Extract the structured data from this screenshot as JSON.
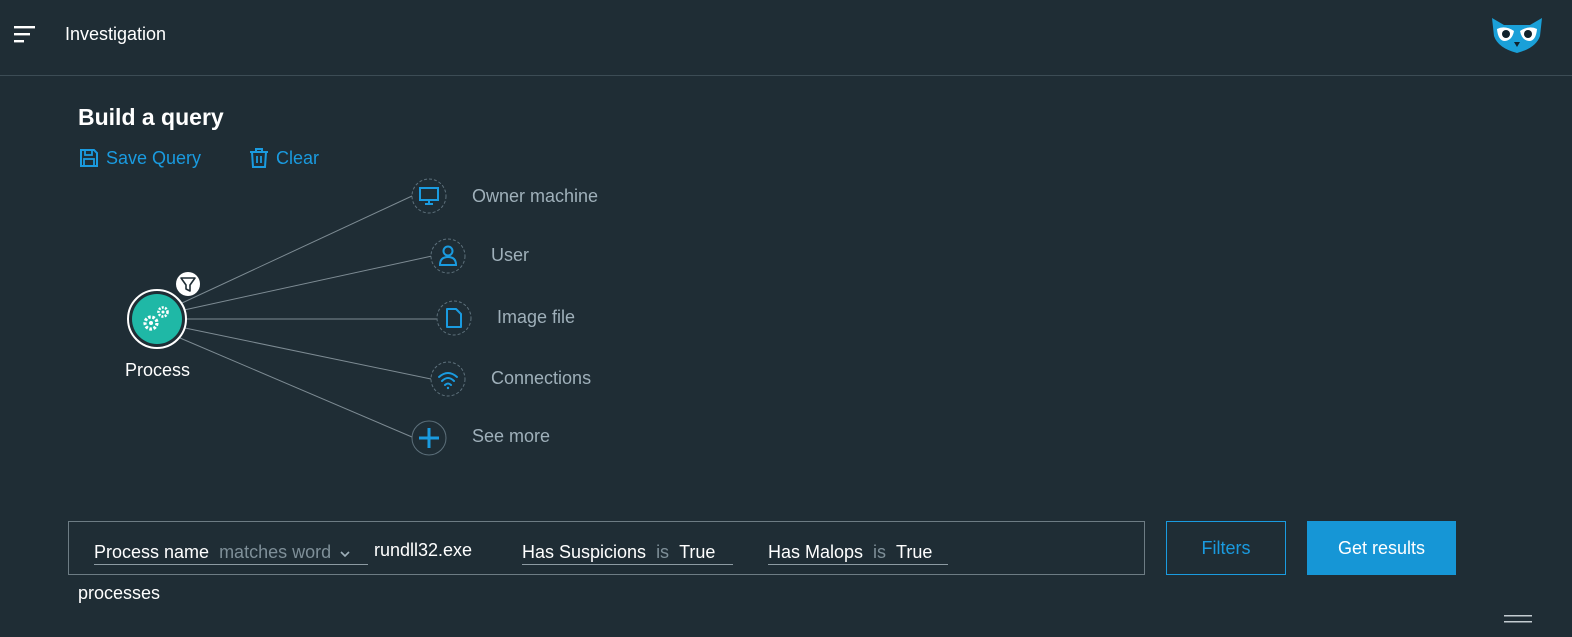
{
  "header": {
    "title": "Investigation"
  },
  "builder": {
    "title": "Build a query",
    "save_label": "Save Query",
    "clear_label": "Clear"
  },
  "graph": {
    "root_label": "Process",
    "nodes": [
      {
        "label": "Owner machine",
        "icon": "monitor-icon"
      },
      {
        "label": "User",
        "icon": "user-icon"
      },
      {
        "label": "Image file",
        "icon": "file-icon"
      },
      {
        "label": "Connections",
        "icon": "wifi-icon"
      },
      {
        "label": "See more",
        "icon": "plus-icon"
      }
    ]
  },
  "query": {
    "conditions": [
      {
        "field": "Process name",
        "operator": "matches word",
        "value": "rundll32.exe"
      },
      {
        "field": "Has Suspicions",
        "operator": "is",
        "value": "True"
      },
      {
        "field": "Has Malops",
        "operator": "is",
        "value": "True"
      }
    ],
    "filters_label": "Filters",
    "get_results_label": "Get results",
    "result_type": "processes"
  },
  "colors": {
    "background": "#1f2d35",
    "accent": "#1a9be0",
    "process_node": "#1fb8a6"
  }
}
